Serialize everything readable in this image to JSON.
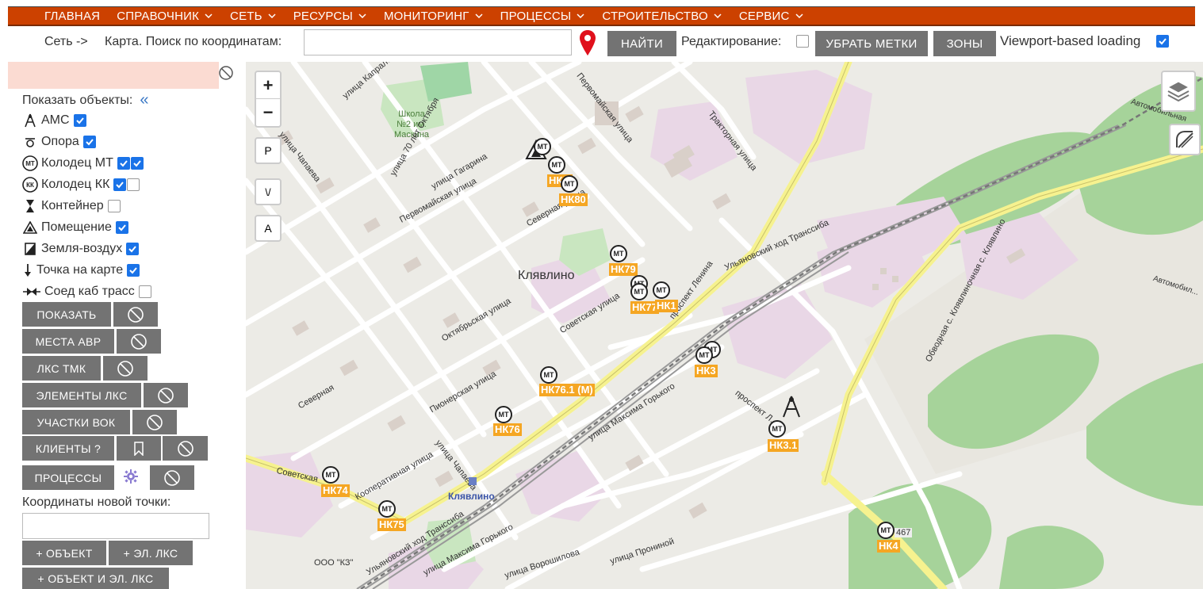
{
  "nav": {
    "items": [
      {
        "label": "ГЛАВНАЯ",
        "dropdown": false
      },
      {
        "label": "СПРАВОЧНИК",
        "dropdown": true
      },
      {
        "label": "СЕТЬ",
        "dropdown": true
      },
      {
        "label": "РЕСУРСЫ",
        "dropdown": true
      },
      {
        "label": "МОНИТОРИНГ",
        "dropdown": true
      },
      {
        "label": "ПРОЦЕССЫ",
        "dropdown": true
      },
      {
        "label": "СТРОИТЕЛЬСТВО",
        "dropdown": true
      },
      {
        "label": "СЕРВИС",
        "dropdown": true
      }
    ]
  },
  "toolbar": {
    "breadcrumb": "Сеть ->",
    "search_label": "Карта. Поиск по координатам:",
    "search_value": "",
    "find_label": "НАЙТИ",
    "edit_label": "Редактирование:",
    "edit_checked": false,
    "remove_marks_label": "УБРАТЬ МЕТКИ",
    "zones_label": "ЗОНЫ",
    "viewport_label": "Viewport-based loading",
    "viewport_checked": true
  },
  "sidebar": {
    "filter_value": "",
    "show_objects_label": "Показать объекты:",
    "collapse_glyph": "«",
    "objects": [
      {
        "label": "АМС",
        "icon": "tower-icon",
        "checks": [
          true
        ]
      },
      {
        "label": "Опора",
        "icon": "pole-icon",
        "checks": [
          true
        ]
      },
      {
        "label": "Колодец МТ",
        "icon": "well-mt-icon",
        "icon_text": "МТ",
        "checks": [
          true,
          true
        ]
      },
      {
        "label": "Колодец КК",
        "icon": "well-kk-icon",
        "icon_text": "КК",
        "checks": [
          true,
          false
        ]
      },
      {
        "label": "Контейнер",
        "icon": "container-icon",
        "checks": [
          false
        ]
      },
      {
        "label": "Помещение",
        "icon": "room-icon",
        "checks": [
          true
        ]
      },
      {
        "label": "Земля-воздух",
        "icon": "ground-air-icon",
        "checks": [
          true
        ]
      },
      {
        "label": "Точка на карте",
        "icon": "map-point-icon",
        "checks": [
          true
        ]
      },
      {
        "label": "Соед каб трасс",
        "icon": "cable-joint-icon",
        "checks": [
          false
        ]
      }
    ],
    "buttons": {
      "show": "ПОКАЗАТЬ",
      "avr": "МЕСТА АВР",
      "lks_tmk": "ЛКС ТМК",
      "lks_elements": "ЭЛЕМЕНТЫ ЛКС",
      "vok": "УЧАСТКИ ВОК",
      "clients": "КЛИЕНТЫ ?",
      "processes": "ПРОЦЕССЫ"
    },
    "coords_label": "Координаты новой точки:",
    "coords_value": "",
    "add_object": "+ ОБЪЕКТ",
    "add_lks": "+ ЭЛ. ЛКС",
    "add_object_lks": "+ ОБЪЕКТ И ЭЛ. ЛКС"
  },
  "map": {
    "zoom_in": "+",
    "zoom_out": "−",
    "btn_p": "P",
    "btn_v": "\\/",
    "btn_a": "A",
    "town": "Клявлино",
    "station": "Клявлино",
    "school": "Школа №2 им. Маскина",
    "ooo": "ООО \"КЗ\"",
    "code": "467",
    "streets": {
      "sovetskaya": "Советская улица",
      "sovetskaya2": "Советская",
      "pervomayskaya": "Первомайская улица",
      "pervomayskaya2": "Первомайская улица",
      "traktornaya": "Тракторная улица",
      "chapaeva": "улица Чапаева",
      "chapaeva2": "улица Чапаева",
      "gagarina": "улица Гагарина",
      "oct70": "улица 70 лет Октября",
      "oktyabrskaya": "Октябрьская улица",
      "pionerskaya": "Пионерская улица",
      "kooperativnaya": "Кооперативная улица",
      "severnaya": "Северная улица",
      "severnaya2": "Северная",
      "gorkogo": "улица Максима Горького",
      "gorkogo2": "улица Максима Горького",
      "lenina": "проспект Ленина",
      "lenina2": "проспект Л...",
      "ulyanovsky": "Ульяновский ход Транссиба",
      "ulyanovsky2": "Ульяновский ход Транссиба",
      "obvodnaya": "Обводная с. Клявлиночная с. Клявлино",
      "voroshilova": "улица Ворошилова",
      "pronina": "улица Прониной",
      "kaprala": "улица Капралова",
      "avtomob": "Автомобильная",
      "avtomob2": "Автомобил..."
    },
    "markers": [
      {
        "label": "НК...",
        "glyph": "МТ"
      },
      {
        "label": "НК80",
        "glyph": "МТ"
      },
      {
        "label": "НК79",
        "glyph": "МТ"
      },
      {
        "label": "НК77",
        "glyph": "МТ"
      },
      {
        "label": "НК1",
        "glyph": "МТ"
      },
      {
        "label": "НК3",
        "glyph": "МТ"
      },
      {
        "label": "НК76.1 (М)",
        "glyph": "МТ"
      },
      {
        "label": "НК76",
        "glyph": "МТ"
      },
      {
        "label": "НК3.1",
        "glyph": "МТ"
      },
      {
        "label": "НК74",
        "glyph": "МТ"
      },
      {
        "label": "НК75",
        "glyph": "МТ"
      },
      {
        "label": "НК4",
        "glyph": "МТ"
      }
    ]
  },
  "colors": {
    "nav": "#cc4100",
    "button": "#737373",
    "check": "#1a73e8",
    "pin": "#e0101c",
    "marker_label": "#f5a623"
  }
}
